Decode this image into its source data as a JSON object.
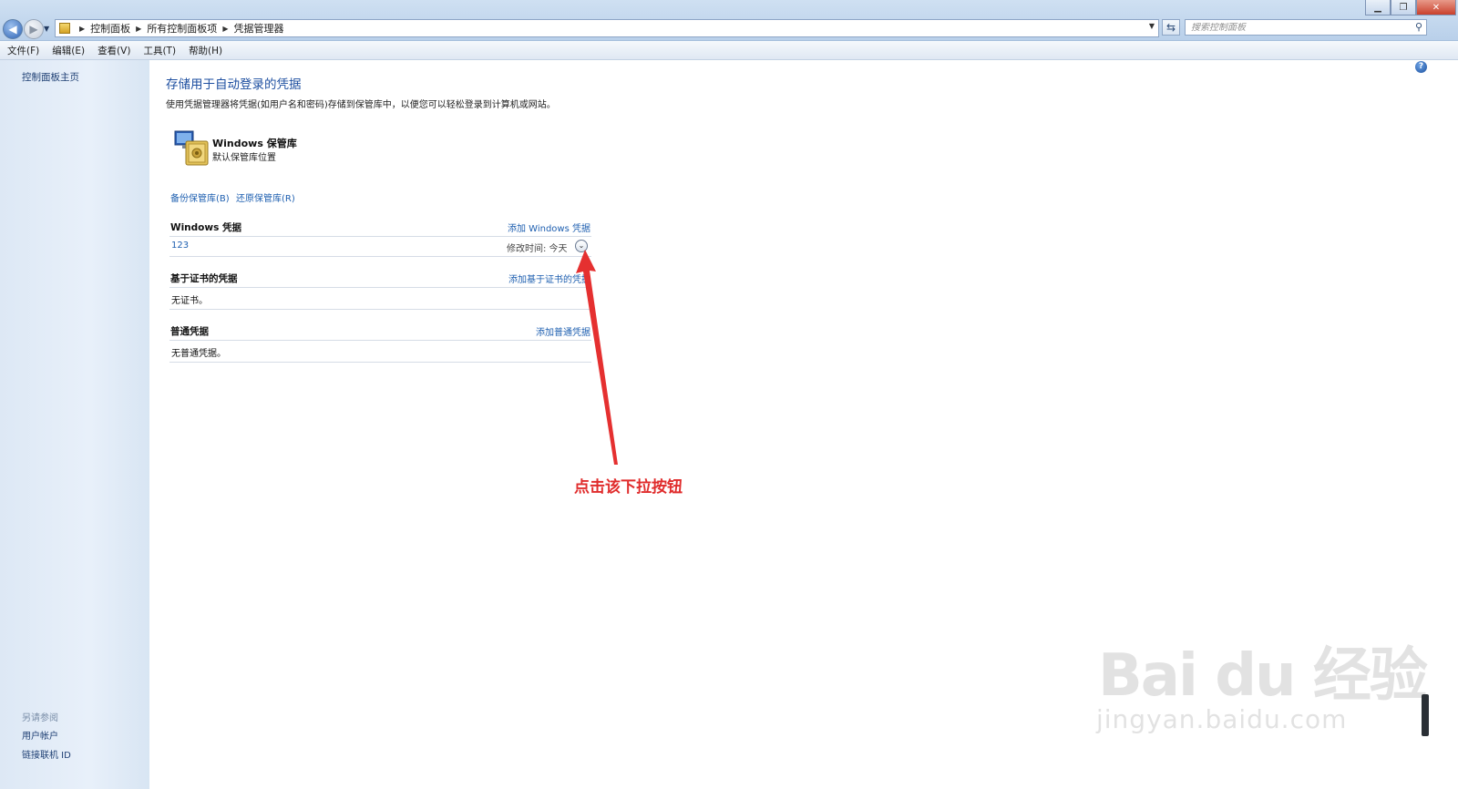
{
  "address_bar": {
    "breadcrumbs": [
      "控制面板",
      "所有控制面板项",
      "凭据管理器"
    ],
    "search_placeholder": "搜索控制面板"
  },
  "menu": [
    "文件(F)",
    "编辑(E)",
    "查看(V)",
    "工具(T)",
    "帮助(H)"
  ],
  "sidebar": {
    "home": "控制面板主页",
    "see_also": "另请参阅",
    "links": [
      "用户帐户",
      "链接联机 ID"
    ]
  },
  "main": {
    "title": "存储用于自动登录的凭据",
    "description": "使用凭据管理器将凭据(如用户名和密码)存储到保管库中，以便您可以轻松登录到计算机或网站。",
    "vault": {
      "title": "Windows 保管库",
      "subtitle": "默认保管库位置"
    },
    "backup_link": "备份保管库(B)",
    "restore_link": "还原保管库(R)",
    "sections": [
      {
        "heading": "Windows 凭据",
        "add_link": "添加 Windows 凭据"
      },
      {
        "heading": "基于证书的凭据",
        "add_link": "添加基于证书的凭据",
        "empty": "无证书。"
      },
      {
        "heading": "普通凭据",
        "add_link": "添加普通凭据",
        "empty": "无普通凭据。"
      }
    ],
    "windows_credential": {
      "name": "123",
      "modified": "修改时间: 今天"
    }
  },
  "annotation": "点击该下拉按钮",
  "watermark": {
    "line1": "Bai du 经验",
    "line2": "jingyan.baidu.com"
  },
  "colors": {
    "link": "#1e5fb0",
    "annotation": "#e02c2c",
    "title": "#1e4fa0"
  }
}
